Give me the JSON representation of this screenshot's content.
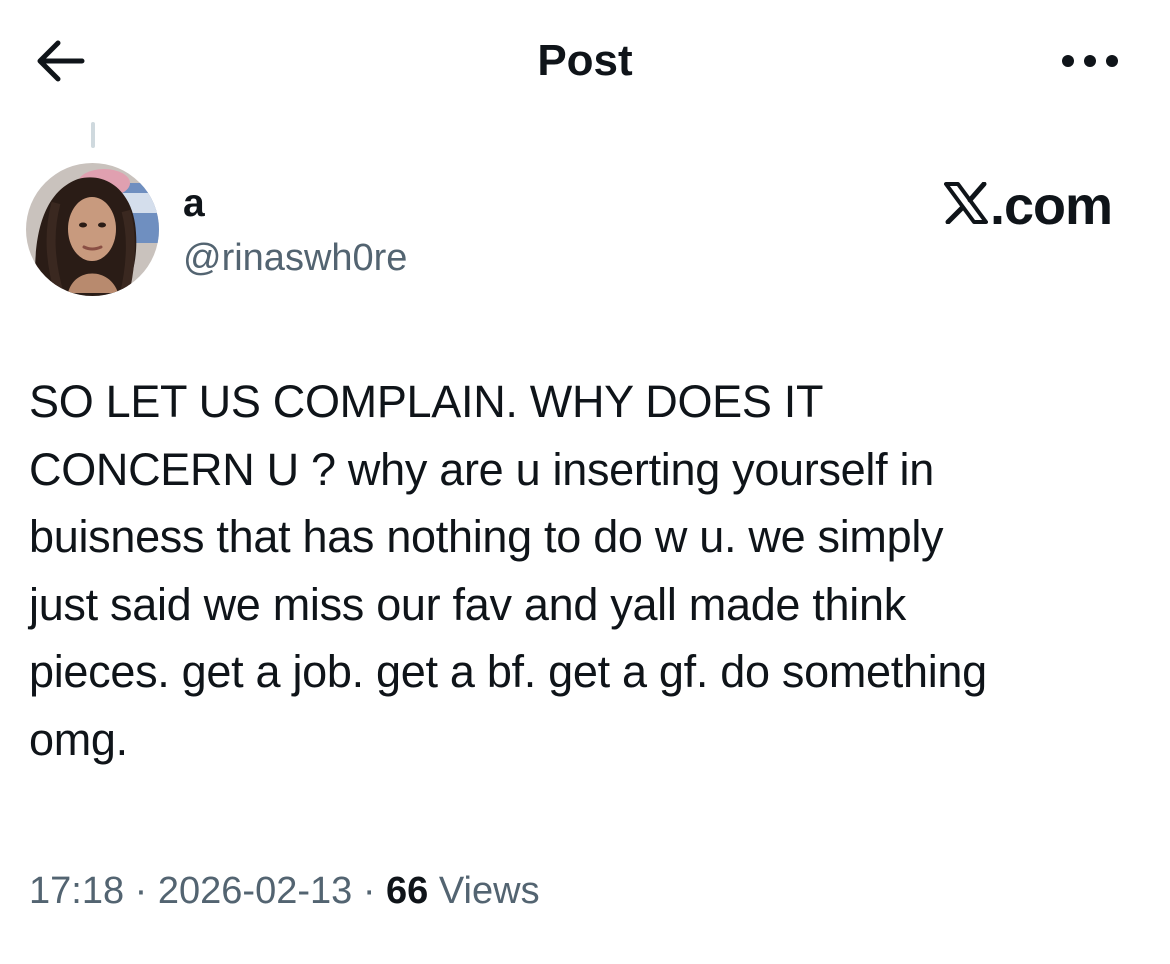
{
  "header": {
    "title": "Post",
    "back_icon": "arrow-left-icon",
    "more_icon": "more-horizontal-icon"
  },
  "post": {
    "author": {
      "display_name": "a",
      "handle": "@rinaswh0re",
      "avatar_icon": "avatar-photo"
    },
    "watermark": "X.com",
    "watermark_text": ".com",
    "body_lines": [
      "SO LET US COMPLAIN. WHY DOES IT",
      "CONCERN U ? why are u inserting yourself in",
      "buisness that has nothing to do w u. we simply",
      "just said we miss our fav and yall made think",
      "pieces. get a job. get a bf. get a gf. do something",
      "omg."
    ],
    "meta": {
      "time": "17:18",
      "separator": " · ",
      "date": "2026-02-13",
      "views_count": "66",
      "views_label": " Views"
    }
  },
  "colors": {
    "text_primary": "#0f1419",
    "text_secondary": "#536471",
    "background": "#ffffff",
    "thread_line": "#cfd9de"
  }
}
